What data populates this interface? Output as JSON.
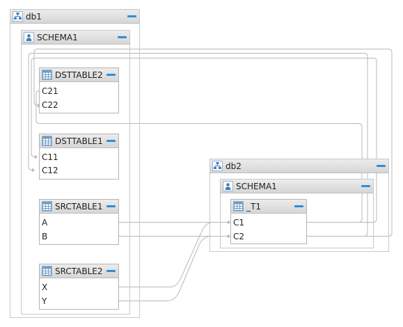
{
  "databases": [
    {
      "name": "db1",
      "schemas": [
        {
          "name": "SCHEMA1",
          "tables": [
            {
              "name": "DSTTABLE2",
              "columns": [
                "C21",
                "C22"
              ]
            },
            {
              "name": "DSTTABLE1",
              "columns": [
                "C11",
                "C12"
              ]
            },
            {
              "name": "SRCTABLE1",
              "columns": [
                "A",
                "B"
              ]
            },
            {
              "name": "SRCTABLE2",
              "columns": [
                "X",
                "Y"
              ]
            }
          ]
        }
      ]
    },
    {
      "name": "db2",
      "schemas": [
        {
          "name": "SCHEMA1",
          "tables": [
            {
              "name": "_T1",
              "columns": [
                "C1",
                "C2"
              ]
            }
          ]
        }
      ]
    }
  ],
  "icons": {
    "database": "database-icon",
    "schema": "schema-user-icon",
    "table": "table-grid-icon",
    "collapse": "minus-icon"
  },
  "colors": {
    "collapse_button": "#2f8dd6",
    "connector": "#b8b8b8"
  }
}
